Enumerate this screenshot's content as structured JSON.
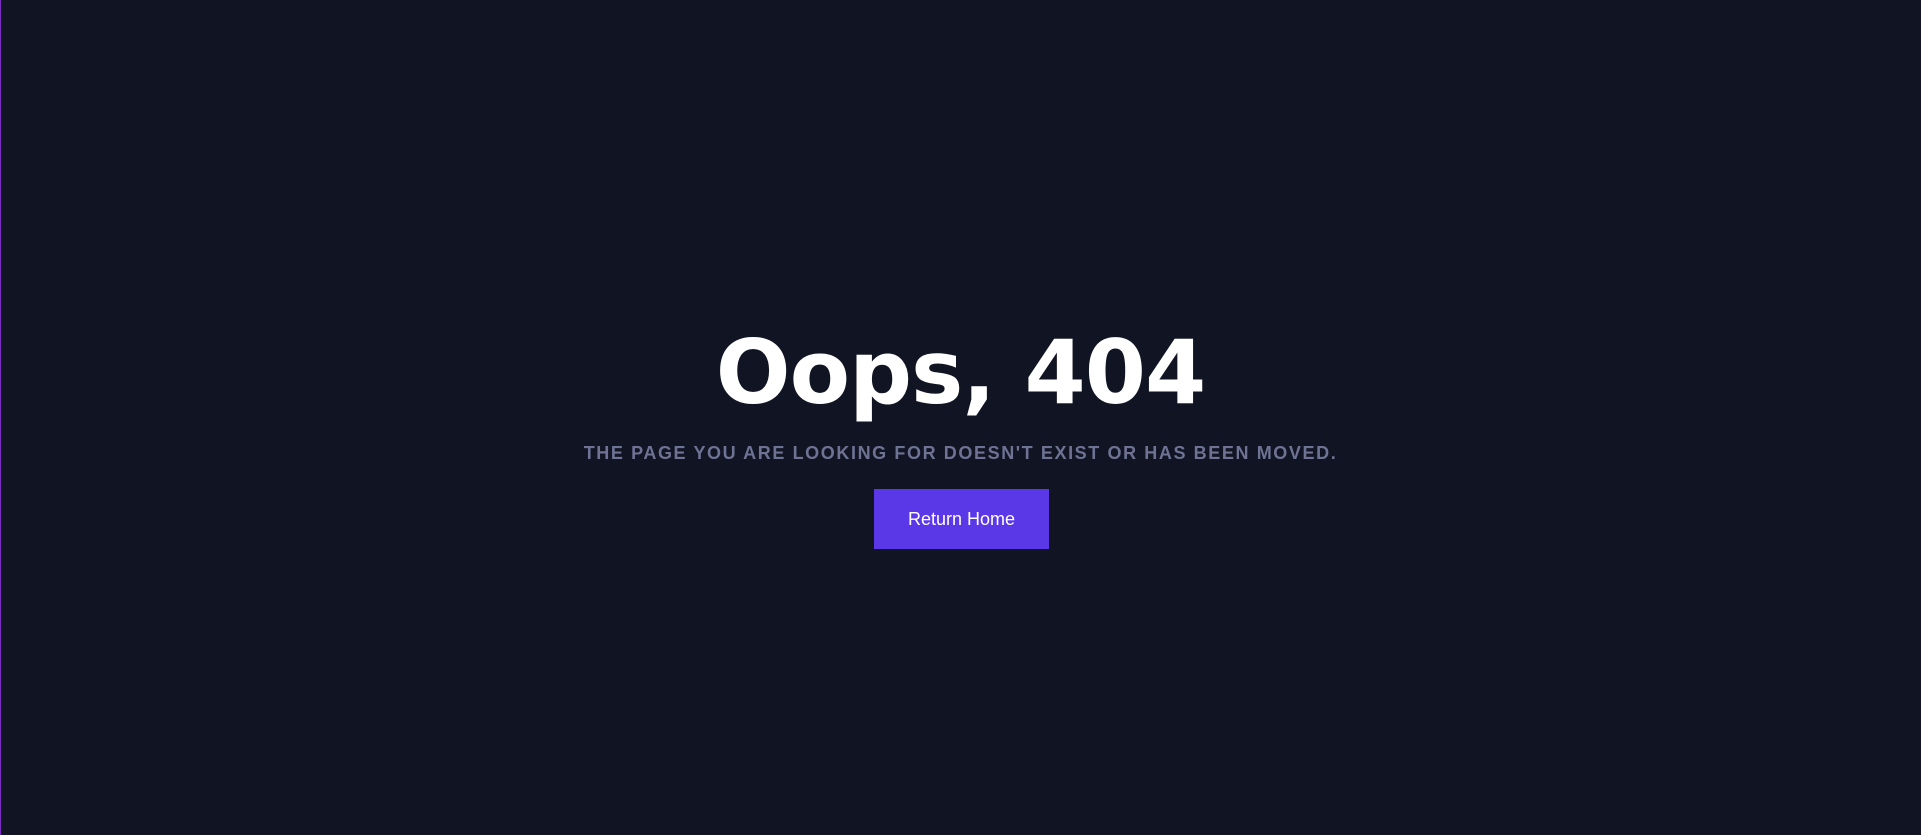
{
  "page": {
    "background_color": "#111423",
    "edge_accent_color": "#7b2cbf"
  },
  "error": {
    "headline": "Oops, 404",
    "message": "THE PAGE YOU ARE LOOKING FOR DOESN'T EXIST OR HAS BEEN MOVED.",
    "button_label": "Return Home",
    "button_color": "#5a38e8",
    "message_color": "#6e7394"
  }
}
